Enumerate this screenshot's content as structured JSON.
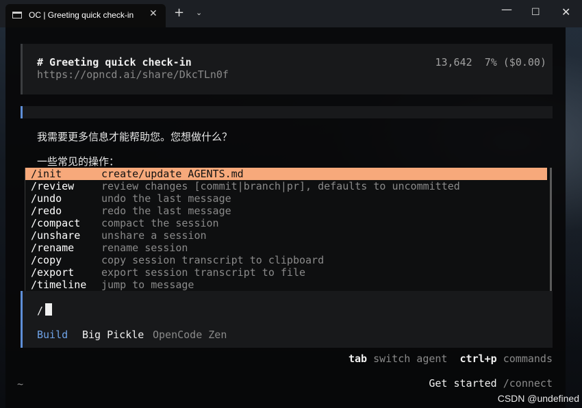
{
  "window": {
    "tab_title": "OC | Greeting quick check-in",
    "tab_close": "✕",
    "new_tab": "+",
    "dropdown": "⌄",
    "minimize": "—",
    "maximize": "☐",
    "close": "✕"
  },
  "session": {
    "title": "# Greeting quick check-in",
    "share_url": "https://opncd.ai/share/DkcTLn0f",
    "tokens": "13,642",
    "usage": "7% ($0.00)"
  },
  "message": {
    "line1": "我需要更多信息才能帮助您。您想做什么？",
    "line2": "一些常见的操作："
  },
  "commands": [
    {
      "name": "/init",
      "desc": "create/update AGENTS.md",
      "selected": true
    },
    {
      "name": "/review",
      "desc": "review changes [commit|branch|pr], defaults to uncommitted",
      "selected": false
    },
    {
      "name": "/undo",
      "desc": "undo the last message",
      "selected": false
    },
    {
      "name": "/redo",
      "desc": "redo the last message",
      "selected": false
    },
    {
      "name": "/compact",
      "desc": "compact the session",
      "selected": false
    },
    {
      "name": "/unshare",
      "desc": "unshare a session",
      "selected": false
    },
    {
      "name": "/rename",
      "desc": "rename session",
      "selected": false
    },
    {
      "name": "/copy",
      "desc": "copy session transcript to clipboard",
      "selected": false
    },
    {
      "name": "/export",
      "desc": "export session transcript to file",
      "selected": false
    },
    {
      "name": "/timeline",
      "desc": "jump to message",
      "selected": false
    }
  ],
  "input": {
    "value": "/"
  },
  "status": {
    "mode": "Build",
    "model": "Big Pickle",
    "provider": "OpenCode Zen"
  },
  "hints": {
    "tab_key": "tab",
    "tab_text": "switch agent",
    "cmd_key": "ctrl+p",
    "cmd_text": "commands"
  },
  "footer": {
    "cwd": "~",
    "get_started": "Get started",
    "connect": "/connect"
  },
  "watermark": "CSDN @undefined",
  "colors": {
    "accent_blue": "#5e8fd8",
    "selection": "#f7a97b"
  }
}
